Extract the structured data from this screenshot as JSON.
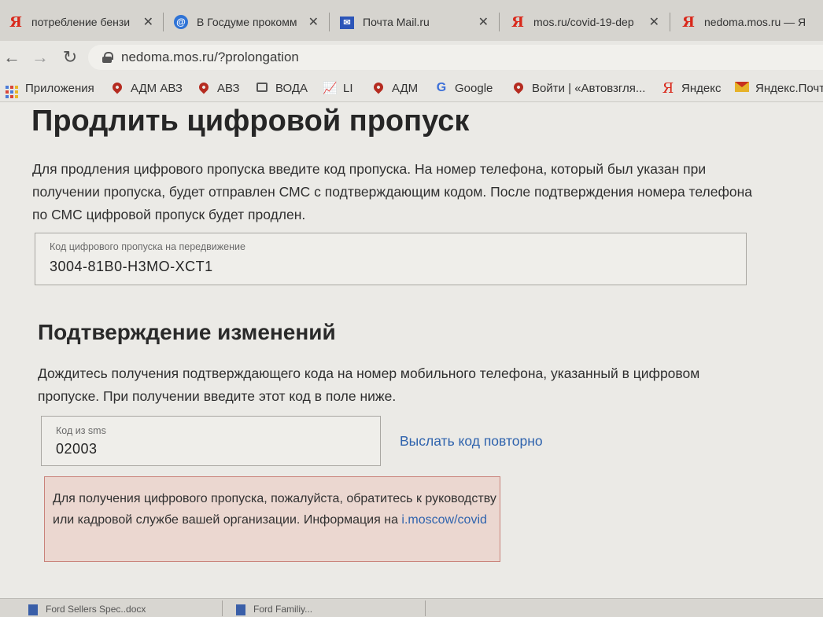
{
  "browser": {
    "tabs": [
      {
        "title": "потребление бензи",
        "favicon": "yandex-icon"
      },
      {
        "title": "В Госдуме прокомм",
        "favicon": "mail-at-icon"
      },
      {
        "title": "Почта Mail.ru",
        "favicon": "mailru-icon"
      },
      {
        "title": "mos.ru/covid-19-dep",
        "favicon": "yandex-icon"
      },
      {
        "title": "nedoma.mos.ru — Я",
        "favicon": "yandex-icon"
      }
    ],
    "url": "nedoma.mos.ru/?prolongation",
    "bookmarks": [
      {
        "label": "Приложения",
        "icon": "apps-icon"
      },
      {
        "label": "АДМ АВЗ",
        "icon": "map-pin-icon"
      },
      {
        "label": "АВЗ",
        "icon": "map-pin-icon"
      },
      {
        "label": "ВОДА",
        "icon": "chat-icon"
      },
      {
        "label": "LI",
        "icon": "chart-icon"
      },
      {
        "label": "АДМ",
        "icon": "map-pin-icon"
      },
      {
        "label": "Google",
        "icon": "google-icon"
      },
      {
        "label": "Войти | «Автовзгля...",
        "icon": "map-pin-icon"
      },
      {
        "label": "Яндекс",
        "icon": "yandex-icon"
      },
      {
        "label": "Яндекс.Почт",
        "icon": "yandex-mail-icon"
      }
    ]
  },
  "page": {
    "title": "Продлить цифровой пропуск",
    "intro": "Для продления цифрового пропуска введите код пропуска. На номер телефона, который был указан при получении пропуска, будет отправлен СМС с подтверждающим кодом. После подтверждения номера телефона по СМС цифровой пропуск будет продлен.",
    "pass_field": {
      "label": "Код цифрового пропуска на передвижение",
      "value": "3004-81B0-H3MO-XCT1"
    },
    "confirm_title": "Подтверждение изменений",
    "confirm_text": "Дождитесь получения подтверждающего кода на номер мобильного телефона, указанный в цифровом пропуске. При получении введите этот код в поле ниже.",
    "sms_field": {
      "label": "Код из sms",
      "value": "02003"
    },
    "resend_link": "Выслать код повторно",
    "error": {
      "text": "Для получения цифрового пропуска, пожалуйста, обратитесь к руководству или кадровой службе вашей организации. Информация на",
      "link": "i.moscow/covid"
    }
  },
  "taskbar": {
    "items": [
      "Ford Sellers Spec..docx",
      "Ford Familiy..."
    ]
  },
  "colors": {
    "link": "#2f63ad",
    "error_bg": "#ebd7d0",
    "error_border": "#c9827a",
    "yandex_red": "#d9271a"
  }
}
